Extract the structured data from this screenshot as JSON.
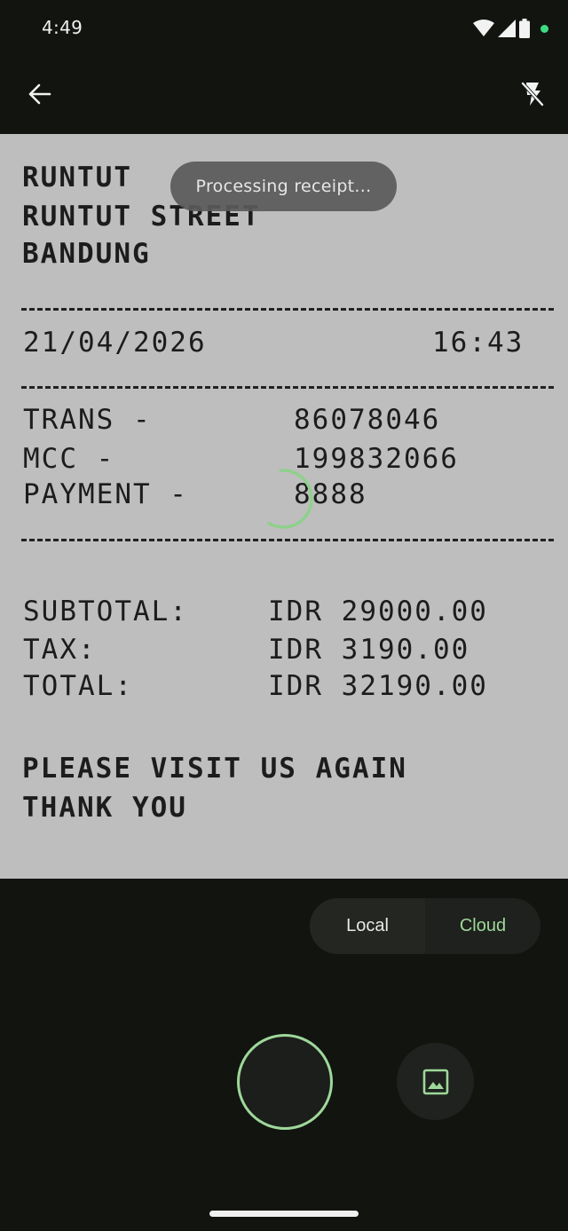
{
  "status_bar": {
    "time": "4:49",
    "icons": [
      "wifi-icon",
      "signal-icon",
      "battery-icon",
      "camera-in-use-dot"
    ]
  },
  "top_bar": {
    "back_icon": "arrow-back-icon",
    "flash_icon": "flash-off-icon"
  },
  "toast": {
    "text": "Processing receipt..."
  },
  "receipt": {
    "header": [
      "RUNTUT",
      "RUNTUT STREET",
      "BANDUNG"
    ],
    "date": "21/04/2026",
    "time": "16:43",
    "details": [
      {
        "label": "TRANS -",
        "value": "86078046"
      },
      {
        "label": "MCC -",
        "value": "199832066"
      },
      {
        "label": "PAYMENT -",
        "value": "8888"
      }
    ],
    "totals": [
      {
        "label": "SUBTOTAL:",
        "value": "IDR 29000.00"
      },
      {
        "label": "TAX:",
        "value": "IDR 3190.00"
      },
      {
        "label": "TOTAL:",
        "value": "IDR 32190.00"
      }
    ],
    "footer": [
      "PLEASE VISIT US AGAIN",
      "THANK YOU"
    ]
  },
  "mode_switch": {
    "options": [
      "Local",
      "Cloud"
    ],
    "selected": "Cloud"
  },
  "controls": {
    "shutter_icon": "shutter-icon",
    "gallery_icon": "gallery-image-icon"
  },
  "colors": {
    "accent": "#9ed89a",
    "background": "#121410",
    "viewfinder": "#bebebe",
    "camera_dot": "#3ddc84"
  }
}
